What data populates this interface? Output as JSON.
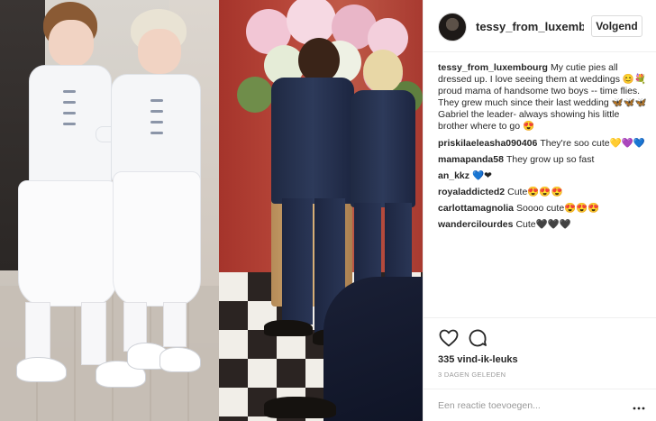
{
  "post": {
    "username": "tessy_from_luxembourg",
    "follow_label": "Volgend"
  },
  "caption": {
    "author": "tessy_from_luxembourg",
    "text": "My cutie pies all dressed up. I love seeing them at weddings 😊💐proud mama of handsome two boys -- time flies. They grew much since their last wedding 🦋🦋🦋Gabriel the leader- always showing his little brother where to go 😍"
  },
  "comments": [
    {
      "author": "priskilaeleasha090406",
      "text": "They're soo cute💛💜💙"
    },
    {
      "author": "mamapanda58",
      "text": "They grow up so fast"
    },
    {
      "author": "an_kkz",
      "text": "💙❤"
    },
    {
      "author": "royaladdicted2",
      "text": "Cute😍😍😍"
    },
    {
      "author": "carlottamagnolia",
      "text": "Soooo cute😍😍😍"
    },
    {
      "author": "wandercilourdes",
      "text": "Cute🖤🖤🖤"
    }
  ],
  "actions": {
    "like_icon": "heart-icon",
    "comment_icon": "comment-icon",
    "likes_text": "335 vind-ik-leuks",
    "date_text": "3 DAGEN GELEDEN"
  },
  "comment_box": {
    "placeholder": "Een reactie toevoegen..."
  },
  "colors": {
    "text": "#262626",
    "muted": "#999999",
    "border": "#efefef"
  }
}
